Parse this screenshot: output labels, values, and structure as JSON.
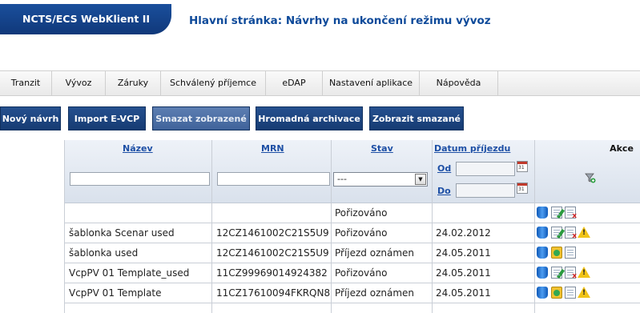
{
  "app": {
    "brand": "NCTS/ECS WebKlient II",
    "page_title": "Hlavní stránka: Návrhy na ukončení režimu vývoz"
  },
  "nav": {
    "items": [
      "Tranzit",
      "Vývoz",
      "Záruky",
      "Schválený příjemce",
      "eDAP",
      "Nastavení aplikace",
      "Nápověda"
    ]
  },
  "toolbar": {
    "new_draft": "Nový návrh",
    "import": "Import E-VCP",
    "delete_shown": "Smazat zobrazené",
    "bulk_archive": "Hromadná archivace",
    "show_deleted": "Zobrazit smazané"
  },
  "table": {
    "headers": {
      "name": "Název",
      "mrn": "MRN",
      "status": "Stav",
      "arrival_date": "Datum příjezdu",
      "actions": "Akce"
    },
    "filters": {
      "status_selected": "---",
      "date_from_label": "Od",
      "date_to_label": "Do",
      "calendar_day": "31"
    },
    "rows": [
      {
        "name": "",
        "mrn": "",
        "status": "Pořizováno",
        "date": ""
      },
      {
        "name": "šablonka Scenar used",
        "mrn": "12CZ1461002C21S5U9",
        "status": "Pořizováno",
        "date": "24.02.2012"
      },
      {
        "name": "šablonka used",
        "mrn": "12CZ1461002C21S5U9",
        "status": "Příjezd oznámen",
        "date": "24.05.2011"
      },
      {
        "name": "VcpPV 01 Template_used",
        "mrn": "11CZ99969014924382",
        "status": "Pořizováno",
        "date": "24.05.2011"
      },
      {
        "name": "VcpPV 01 Template",
        "mrn": "11CZ17610094FKRQN8",
        "status": "Příjezd oznámen",
        "date": "24.05.2011"
      }
    ],
    "warning_glyph": "!",
    "delete_glyph": "x"
  }
}
